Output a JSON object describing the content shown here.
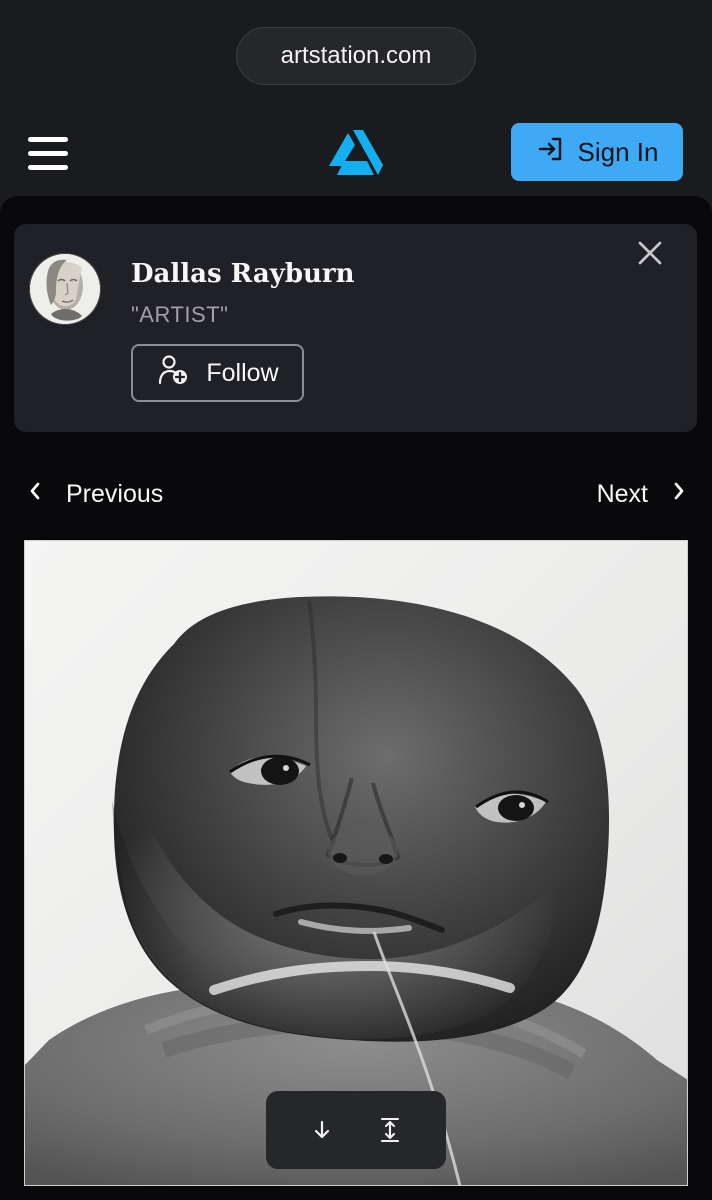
{
  "browser": {
    "url": "artstation.com"
  },
  "header": {
    "menu_icon": "hamburger-menu-icon",
    "logo_icon": "artstation-logo-icon",
    "sign_in_label": "Sign In",
    "sign_in_icon": "sign-in-icon",
    "sign_in_color": "#3ea9f5"
  },
  "artist_card": {
    "name": "Dallas Rayburn",
    "role": "\"ARTIST\"",
    "follow_label": "Follow",
    "follow_icon": "user-plus-icon",
    "close_icon": "close-icon"
  },
  "navigation": {
    "previous_label": "Previous",
    "next_label": "Next",
    "previous_icon": "chevron-left-icon",
    "next_icon": "chevron-right-icon"
  },
  "artwork_toolbar": {
    "download_icon": "arrow-down-icon",
    "expand_icon": "expand-vertical-icon"
  }
}
